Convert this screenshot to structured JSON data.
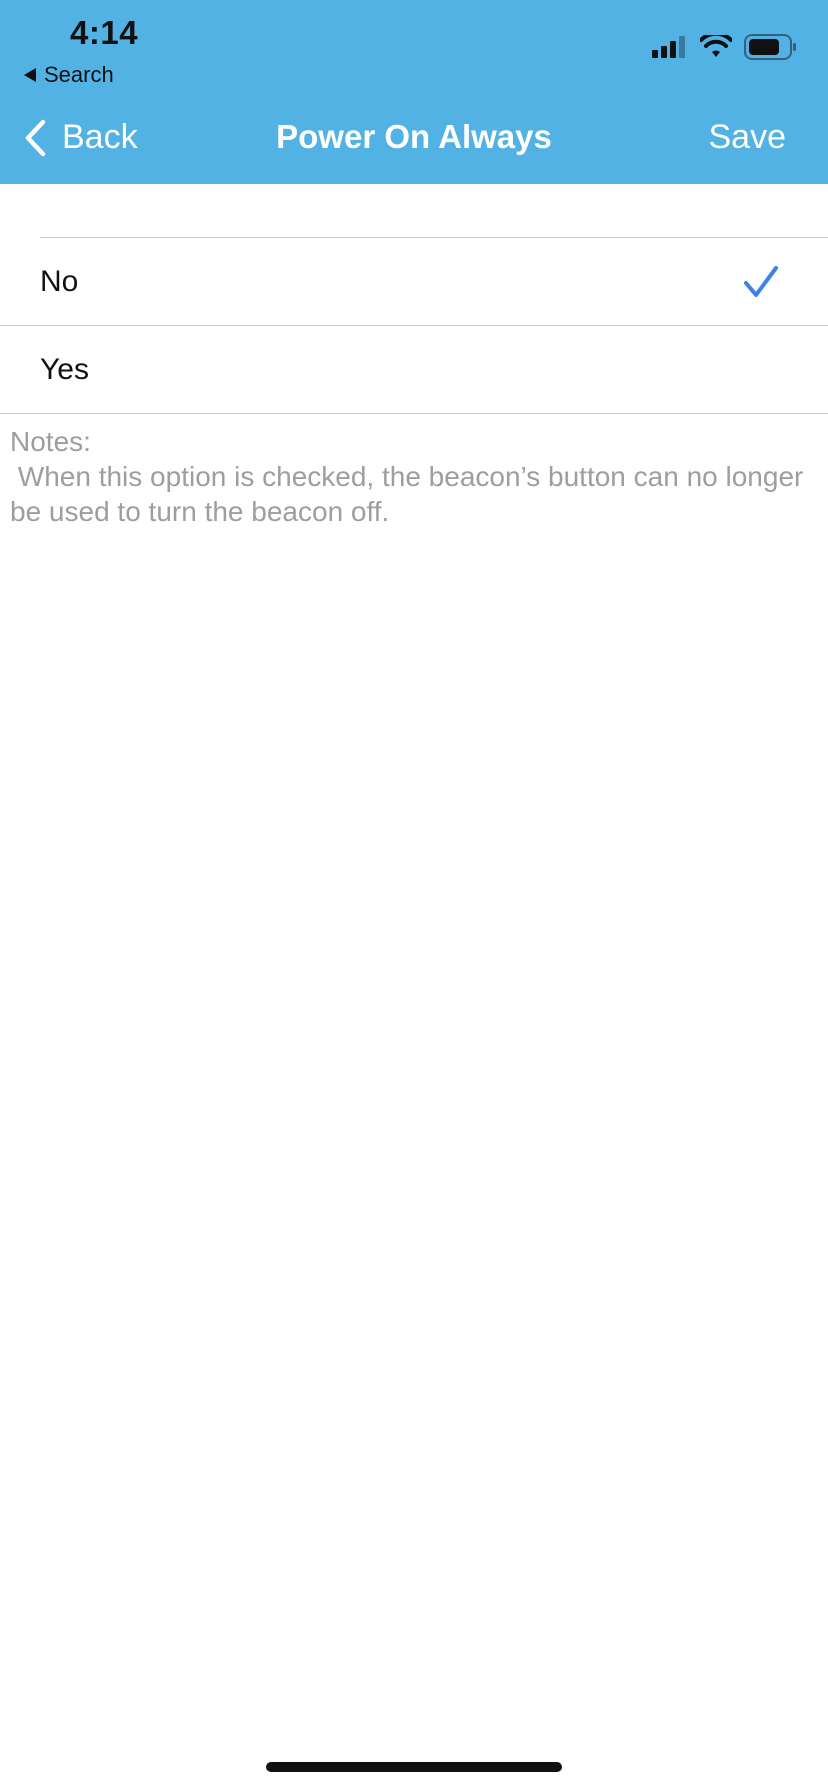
{
  "status_bar": {
    "time": "4:14",
    "back_to_app": "Search"
  },
  "nav": {
    "back_label": "Back",
    "title": "Power On Always",
    "save_label": "Save"
  },
  "options": [
    {
      "label": "No",
      "selected": true
    },
    {
      "label": "Yes",
      "selected": false
    }
  ],
  "notes": {
    "heading": "Notes:",
    "text": " When this option is checked, the beacon’s button can no longer be used to turn the beacon off."
  },
  "colors": {
    "header_bg": "#52b2e4",
    "check": "#3f82e6"
  }
}
